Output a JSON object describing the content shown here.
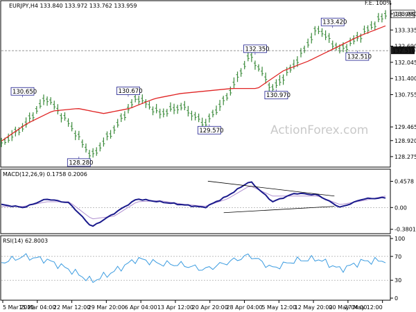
{
  "colors": {
    "price_bars": "#3a8a3a",
    "sma": "#e02424",
    "macd_line": "#1a1a8c",
    "macd_signal": "#b090d0",
    "rsi_line": "#3a9be0",
    "trend_lines": "#000000",
    "panel_border": "#000000",
    "grid": "#e6e6e6"
  },
  "chart_data": [
    {
      "type": "candlestick",
      "symbol_header": "EURJPY,H4  133.840 133.972 133.762 133.959",
      "watermark": "ActionForex.com",
      "y_ticks": [
        128.92,
        128.28,
        129.465,
        130.755,
        131.4,
        132.045,
        132.69,
        133.335,
        133.98
      ],
      "y_tick_labels": [
        "128.920",
        "128.275",
        "129.465",
        "130.755",
        "131.400",
        "132.045",
        "132.690",
        "133.335",
        "133.980"
      ],
      "ylim": [
        128.0,
        134.2
      ],
      "current_price": "133.959",
      "last_label": "132.510",
      "top_right_text": "F.E. 100%",
      "moving_average": [
        128.9,
        129.6,
        130.1,
        130.2,
        130.0,
        130.2,
        130.6,
        130.8,
        130.9,
        131.0,
        131.0,
        131.7,
        132.1,
        132.6,
        133.1,
        133.5
      ],
      "ohlc_path": [
        128.8,
        129.5,
        130.65,
        129.6,
        128.28,
        129.4,
        130.67,
        130.0,
        130.3,
        129.57,
        130.7,
        132.35,
        130.97,
        132.0,
        133.42,
        132.51,
        133.2,
        133.96
      ],
      "swing_labels": [
        {
          "text": "130.650",
          "x": 6,
          "y": 130.65
        },
        {
          "text": "128.280",
          "x": 22,
          "y": 128.28
        },
        {
          "text": "130.670",
          "x": 36,
          "y": 130.67
        },
        {
          "text": "129.570",
          "x": 59,
          "y": 129.57
        },
        {
          "text": "132.350",
          "x": 72,
          "y": 132.35
        },
        {
          "text": "130.970",
          "x": 78,
          "y": 130.97
        },
        {
          "text": "133.420",
          "x": 94,
          "y": 133.42
        },
        {
          "text": "132.510",
          "x": 101,
          "y": 132.51
        }
      ],
      "horizontal_line": 132.51
    },
    {
      "type": "line",
      "title": "MACD(12,26,9) 0.1758 0.2006",
      "y_ticks": [
        0.4578,
        0.0,
        -0.3801
      ],
      "y_tick_labels": [
        "0.4578",
        "0.00",
        "-0.3801"
      ],
      "ylim": [
        -0.42,
        0.5
      ],
      "series": [
        {
          "name": "MACD",
          "values": [
            0.05,
            0.0,
            0.15,
            0.08,
            -0.34,
            -0.1,
            0.15,
            0.1,
            0.05,
            0.0,
            0.2,
            0.46,
            0.1,
            0.25,
            0.22,
            0.0,
            0.15,
            0.17
          ]
        },
        {
          "name": "Signal",
          "values": [
            0.02,
            0.02,
            0.1,
            0.1,
            -0.2,
            -0.15,
            0.1,
            0.12,
            0.06,
            0.02,
            0.15,
            0.38,
            0.2,
            0.2,
            0.2,
            0.05,
            0.12,
            0.2
          ]
        }
      ],
      "trend_lines": [
        {
          "x1": 58.6,
          "y1": 0.46,
          "x2": 94.5,
          "y2": 0.2
        },
        {
          "x1": 63.1,
          "y1": -0.09,
          "x2": 94.5,
          "y2": 0.02
        }
      ]
    },
    {
      "type": "line",
      "title": "RSI(14) 62.8003",
      "y_ticks": [
        100,
        70,
        30,
        0
      ],
      "y_tick_labels": [
        "100",
        "70",
        "30",
        "0"
      ],
      "ylim": [
        0,
        100
      ],
      "series": [
        {
          "name": "RSI",
          "values": [
            60,
            70,
            64,
            48,
            28,
            45,
            66,
            58,
            56,
            48,
            60,
            72,
            50,
            63,
            66,
            48,
            62,
            63
          ]
        }
      ]
    }
  ],
  "x_axis": {
    "labels": [
      "5 Mar 2021",
      "15 Mar 04:00",
      "22 Mar 12:00",
      "29 Mar 20:00",
      "6 Apr 04:00",
      "13 Apr 12:00",
      "20 Apr 20:00",
      "28 Apr 04:00",
      "5 May 12:00",
      "12 May 20:00",
      "20 May 04:00",
      "27 May 12:00"
    ]
  }
}
